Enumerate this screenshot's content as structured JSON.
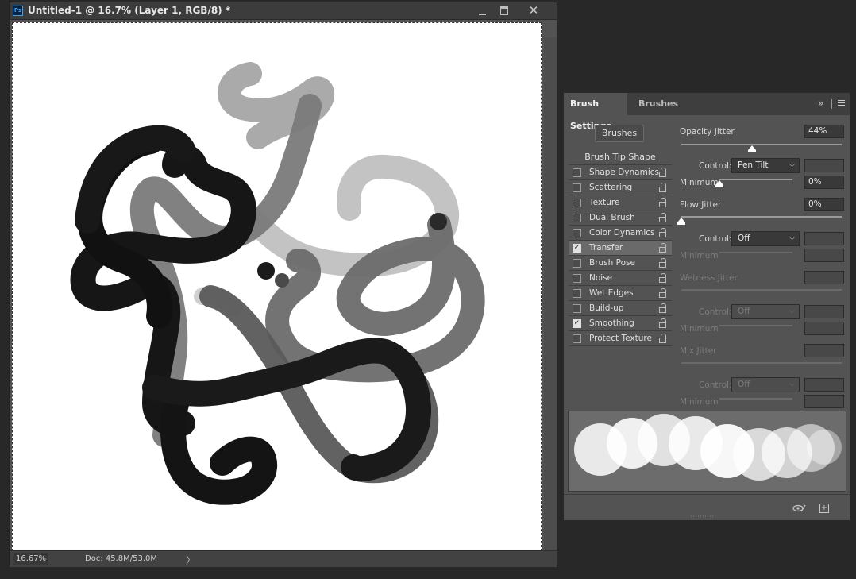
{
  "document": {
    "title": "Untitled-1 @ 16.7% (Layer 1, RGB/8) *",
    "app_icon": "Ps",
    "window_buttons": {
      "minimize": "minimize-icon",
      "maximize": "maximize-icon",
      "close": "close-icon"
    },
    "zoom": "16.67%",
    "doc_info": "Doc: 45.8M/53.0M",
    "status_arrow": "〉"
  },
  "panel": {
    "tabs": [
      "Brush Settings",
      "Brushes"
    ],
    "active_tab": "Brush Settings",
    "expand_glyph": "»",
    "brushes_button": "Brushes",
    "options": [
      {
        "label": "Brush Tip Shape",
        "header": true
      },
      {
        "label": "Shape Dynamics",
        "checked": false
      },
      {
        "label": "Scattering",
        "checked": false
      },
      {
        "label": "Texture",
        "checked": false
      },
      {
        "label": "Dual Brush",
        "checked": false
      },
      {
        "label": "Color Dynamics",
        "checked": false
      },
      {
        "label": "Transfer",
        "checked": true,
        "selected": true
      },
      {
        "label": "Brush Pose",
        "checked": false
      },
      {
        "label": "Noise",
        "checked": false
      },
      {
        "label": "Wet Edges",
        "checked": false
      },
      {
        "label": "Build-up",
        "checked": false
      },
      {
        "label": "Smoothing",
        "checked": true
      },
      {
        "label": "Protect Texture",
        "checked": false
      }
    ],
    "opacity_jitter": {
      "label": "Opacity Jitter",
      "value": "44%",
      "fraction": 0.44
    },
    "opacity_control": {
      "label": "Control:",
      "value": "Pen Tilt"
    },
    "opacity_minimum": {
      "label": "Minimum",
      "value": "0%",
      "fraction": 0.0
    },
    "flow_jitter": {
      "label": "Flow Jitter",
      "value": "0%",
      "fraction": 0.0
    },
    "flow_control": {
      "label": "Control:",
      "value": "Off"
    },
    "flow_minimum": {
      "label": "Minimum"
    },
    "wetness_jitter": {
      "label": "Wetness Jitter"
    },
    "wetness_control": {
      "label": "Control:",
      "value": "Off"
    },
    "wetness_minimum": {
      "label": "Minimum"
    },
    "mix_jitter": {
      "label": "Mix Jitter"
    },
    "mix_control": {
      "label": "Control:",
      "value": "Off"
    },
    "mix_minimum": {
      "label": "Minimum"
    },
    "footer_icons": [
      "proof-visibility-icon",
      "new-preset-icon"
    ]
  },
  "colors": {
    "app_background": "#282828",
    "panel": "#535353",
    "canvas": "#ffffff",
    "accent_ps": "#31a8ff"
  }
}
